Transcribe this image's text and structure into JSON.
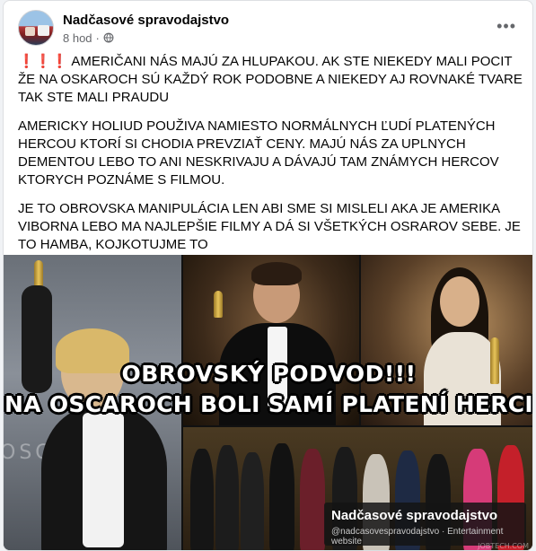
{
  "post": {
    "author": "Nadčasové spravodajstvo",
    "time": "8 hod",
    "separator": "·",
    "more_icon": "more-horizontal-icon",
    "audience_icon": "globe-icon"
  },
  "text": {
    "p1_marks": "❗❗❗",
    "p1": "AMERIČANI NÁS MAJÚ ZA HLUPAKOU. AK STE NIEKEDY MALI POCIT ŽE NA OSKAROCH SÚ KAŽDÝ ROK PODOBNE A NIEKEDY AJ ROVNAKÉ TVARE TAK STE MALI PRAUDU",
    "p2": "AMERICKY HOLIUD POUŽIVA NAMIESTO NORMÁLNYCH ĽUDÍ PLATENÝCH HERCOU KTORÍ SI CHODIA PREVZIAŤ CENY. MAJÚ NÁS ZA UPLNYCH DEMENTOU LEBO TO ANI NESKRIVAJU A DÁVAJÚ TAM ZNÁMYCH HERCOV KTORYCH POZNÁME S FILMOU.",
    "p3": "JE TO OBROVSKA MANIPULÁCIA LEN ABI SME SI MISLELI AKA JE AMERIKA VIBORNA LEBO MA NAJLEPŠIE FILMY A DÁ SI VŠETKÝCH OSRAROV SEBE. JE TO HAMBA, KOJKOTUJME TO"
  },
  "image": {
    "headline_1": "OBROVSKÝ PODVOD!!!",
    "headline_2": "NA OSCAROCH BOLI SAMÍ PLATENÍ HERCI",
    "backdrop_word": "OSCAR",
    "watermark_name": "Nadčasové spravodajstvo",
    "watermark_sub": "@nadcasovespravodajstvo · Entertainment website",
    "corner_credit": "JOBTECH.COM"
  },
  "colors": {
    "accent_red": "#e41e3f",
    "meta_gray": "#65676b"
  }
}
